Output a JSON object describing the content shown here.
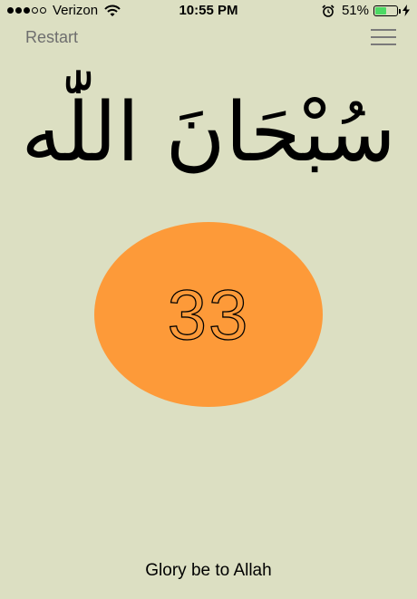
{
  "status_bar": {
    "carrier": "Verizon",
    "time": "10:55 PM",
    "battery_percent": "51%",
    "battery_level": 0.51,
    "battery_color": "#4cd964",
    "signal_bars_filled": 3,
    "signal_bars_total": 5
  },
  "header": {
    "restart_label": "Restart",
    "menu_icon": "hamburger-menu-icon"
  },
  "dhikr": {
    "arabic": "سُبْحَانَ اللّٰه",
    "count": "33",
    "translation": "Glory be to Allah"
  },
  "colors": {
    "background": "#dcdfc2",
    "counter": "#fd9a39",
    "restart_text": "#6e6e6e"
  }
}
